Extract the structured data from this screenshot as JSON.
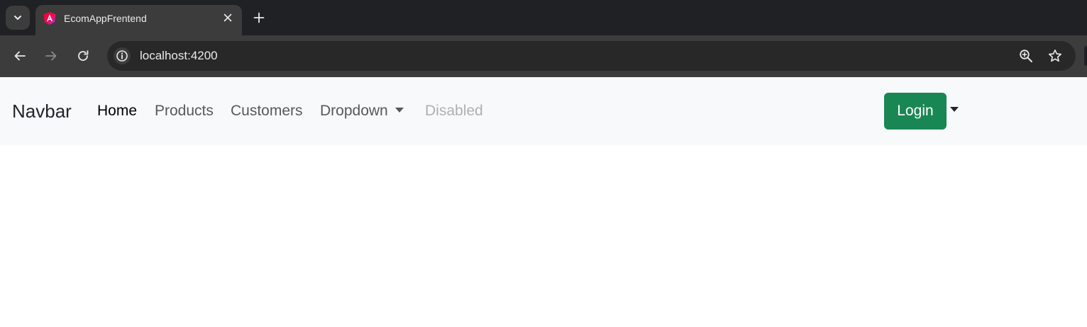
{
  "browser": {
    "tab": {
      "title": "EcomAppFrentend"
    },
    "address_bar": {
      "url": "localhost:4200"
    },
    "icons": {
      "tab_search": "chevron-down-icon",
      "favicon": "angular-logo-icon",
      "close": "close-icon",
      "new_tab": "plus-icon",
      "back": "arrow-left-icon",
      "forward": "arrow-right-icon",
      "reload": "reload-icon",
      "site_info": "info-icon",
      "zoom": "zoom-in-icon",
      "bookmark": "star-icon"
    }
  },
  "navbar": {
    "brand": "Navbar",
    "links": [
      {
        "label": "Home",
        "state": "active"
      },
      {
        "label": "Products",
        "state": "normal"
      },
      {
        "label": "Customers",
        "state": "normal"
      },
      {
        "label": "Dropdown",
        "state": "normal"
      },
      {
        "label": "Disabled",
        "state": "disabled"
      }
    ],
    "login_label": "Login"
  },
  "colors": {
    "chrome_tabstrip": "#202124",
    "chrome_toolbar": "#3c3c3c",
    "navbar_bg": "#f8f9fa",
    "login_button": "#198754"
  }
}
